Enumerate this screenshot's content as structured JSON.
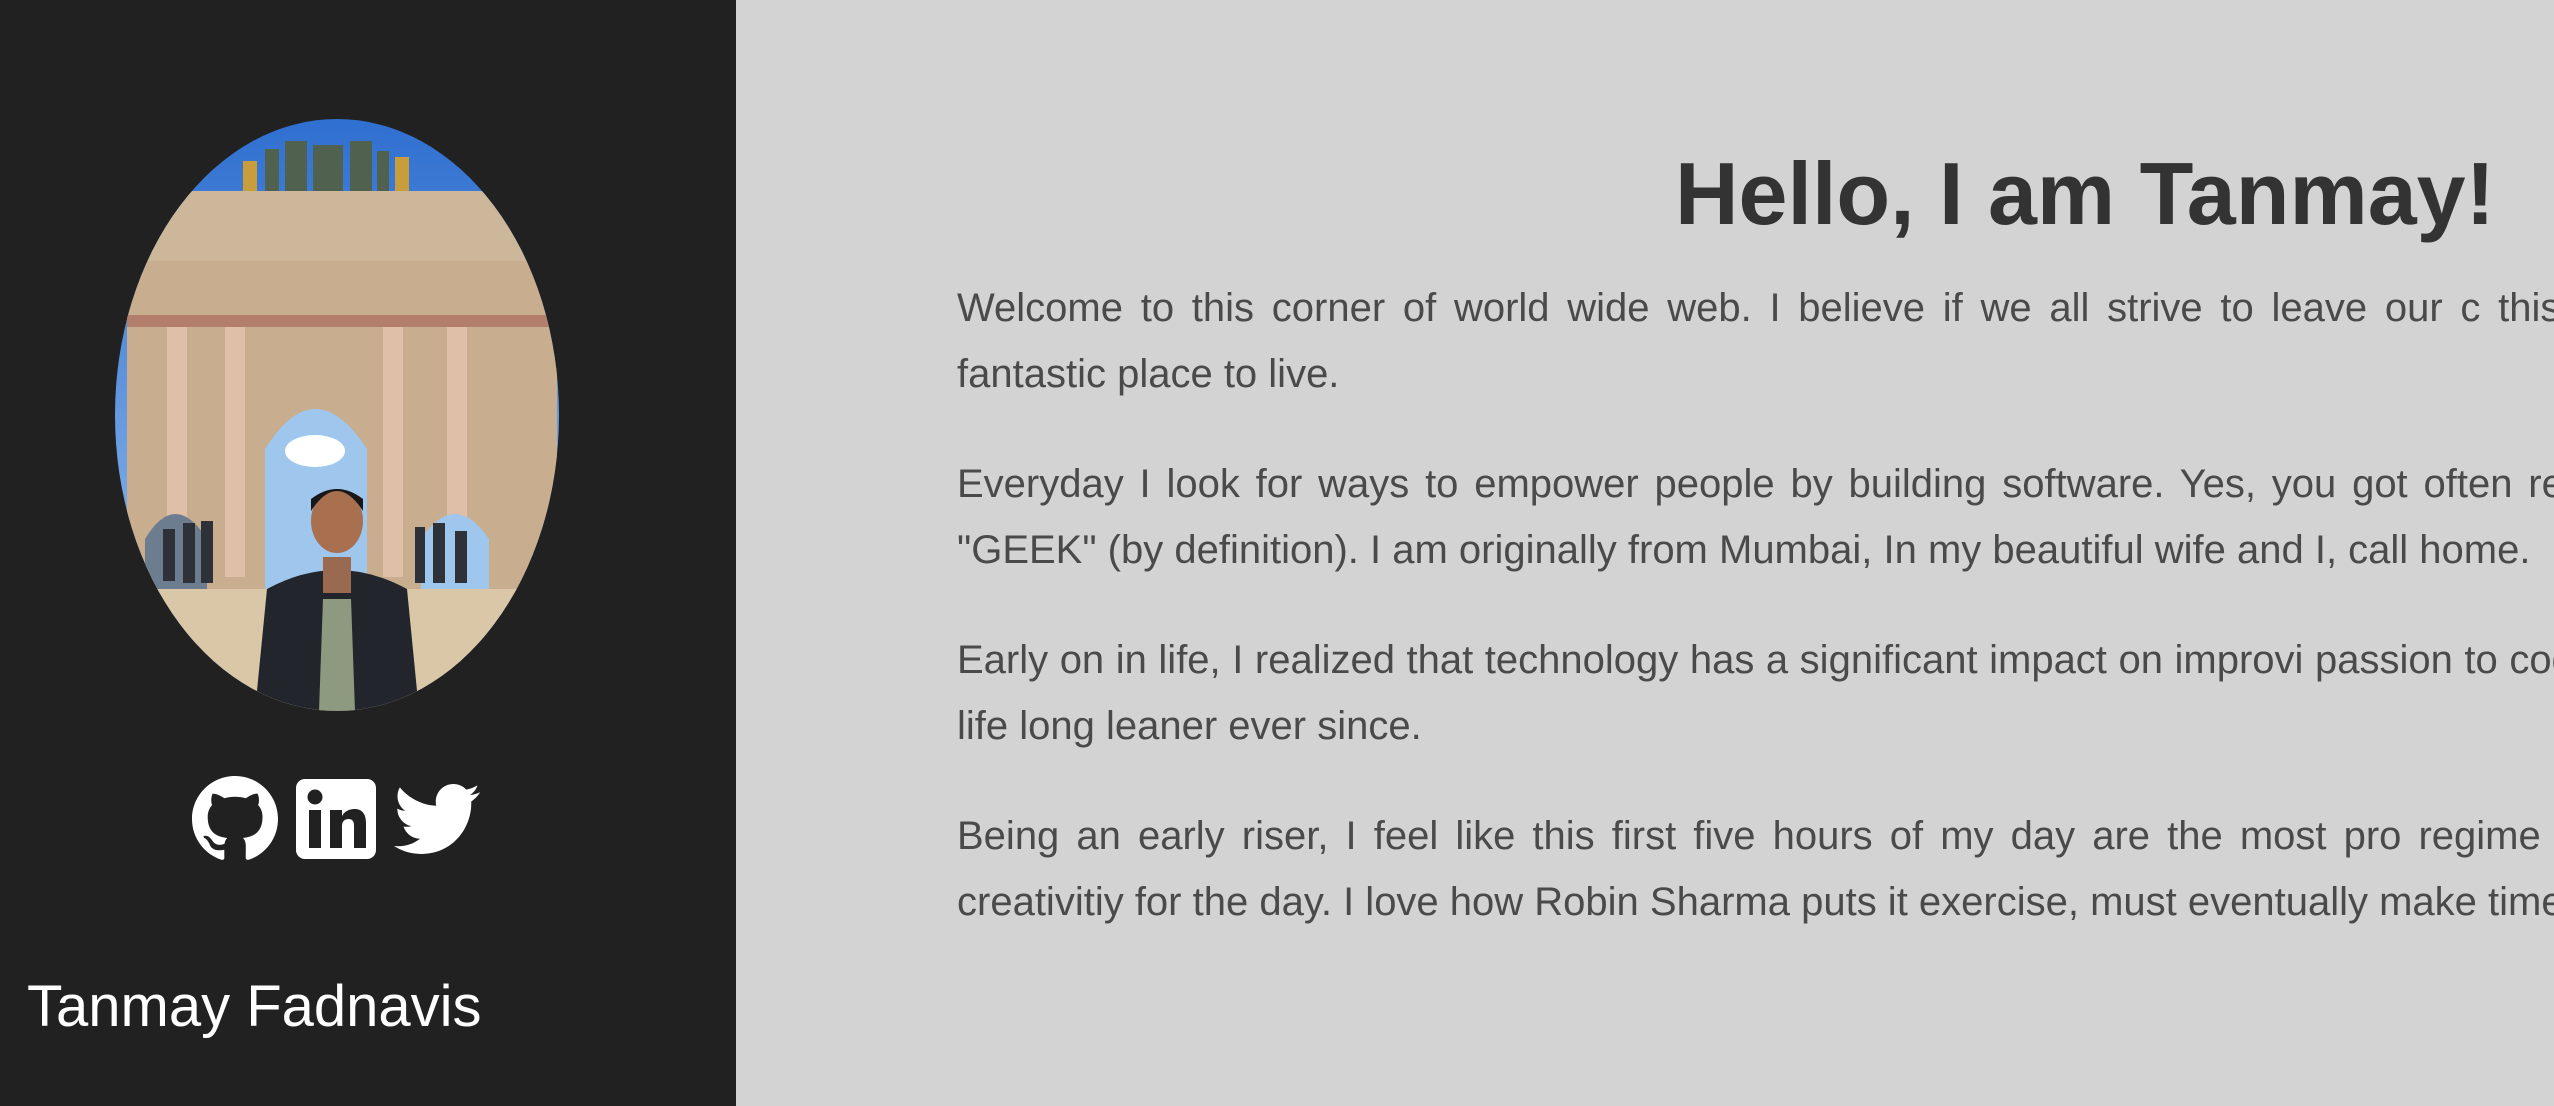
{
  "sidebar": {
    "name": "Tanmay Fadnavis",
    "social_icons": [
      "github-icon",
      "linkedin-icon",
      "twitter-icon"
    ]
  },
  "main": {
    "heading": "Hello, I am Tanmay!",
    "paragraphs": [
      "Welcome to this corner of world wide web. I believe if we all strive to leave our c this would would be a fantastic place to live.",
      "Everyday I look for ways to empower people by building software. Yes, you got often resonate to the word \"GEEK\" (by definition). I am originally from Mumbai, In my beautiful wife and I, call home.",
      "Early on in life, I realized that technology has a significant impact on improvi passion to code and have been a life long leaner ever since.",
      "Being an early riser, I feel like this first five hours of my day are the most pro regime which amps up my creativitiy for the day. I love how Robin Sharma puts it exercise, must eventually make time for illness\"."
    ]
  },
  "colors": {
    "sidebar_bg": "#212121",
    "main_bg": "#d3d3d3",
    "heading": "#333333",
    "body_text": "#4a4a4a"
  }
}
